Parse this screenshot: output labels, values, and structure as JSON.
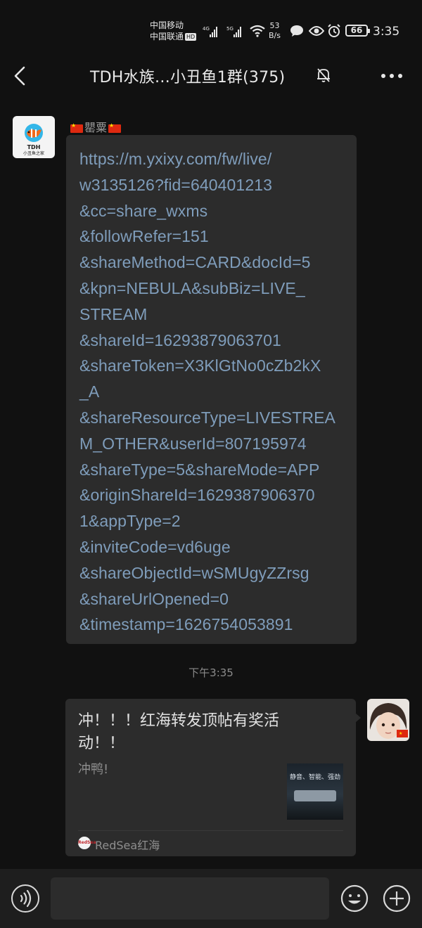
{
  "status_bar": {
    "carrier1": "中国移动",
    "carrier2": "中国联通",
    "hd_badge": "HD",
    "signal1_label": "4G",
    "signal2_label": "5G",
    "net_speed_value": "53",
    "net_speed_unit": "B/s",
    "battery": "66",
    "time": "3:35"
  },
  "header": {
    "title": "TDH水族…小丑鱼1群(375)"
  },
  "messages": {
    "incoming": {
      "sender_name": "罌粟",
      "avatar_text": "TDH",
      "avatar_subtext": "小丑鱼之家",
      "text": "https://m.yxixy.com/fw/live/\nw3135126?fid=640401213\n&cc=share_wxms\n&followRefer=151\n&shareMethod=CARD&docId=5\n&kpn=NEBULA&subBiz=LIVE_\nSTREAM\n&shareId=16293879063701\n&shareToken=X3KlGtNo0cZb2kX\n_A\n&shareResourceType=LIVESTREA\nM_OTHER&userId=807195974\n&shareType=5&shareMode=APP\n&originShareId=1629387906370\n1&appType=2\n&inviteCode=vd6uge\n&shareObjectId=wSMUgyZZrsg\n&shareUrlOpened=0\n&timestamp=1626754053891"
    },
    "timestamp": "下午3:35",
    "outgoing_card": {
      "title": "冲！！！红海转发顶帖有奖活动！！",
      "description": "冲鸭!",
      "thumb_text": "静音、智能、强劲",
      "source_logo_text": "RedSea",
      "source_name": "RedSea红海"
    }
  },
  "input": {
    "placeholder": ""
  },
  "colors": {
    "background": "#111111",
    "bubble": "#2c2c2c",
    "link": "#7f9dbb",
    "input_bar": "#1e1e1e"
  },
  "icons": {
    "back": "chevron-left-icon",
    "mute": "bell-off-icon",
    "more": "more-dots-icon",
    "voice": "voice-icon",
    "emoji": "emoji-icon",
    "plus": "plus-icon"
  }
}
